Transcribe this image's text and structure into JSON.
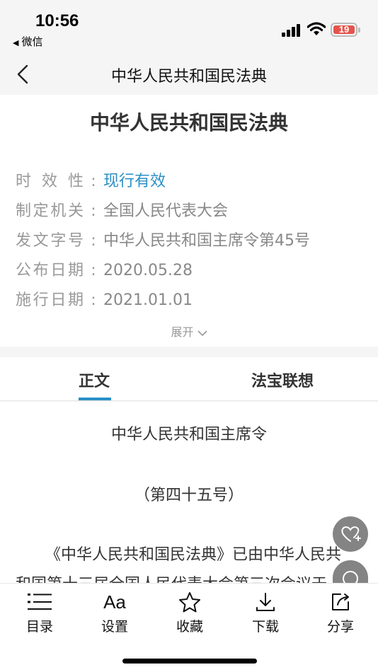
{
  "status_bar": {
    "time": "10:56",
    "back_app": "微信",
    "battery": "19",
    "battery_color": "#e5534b"
  },
  "nav": {
    "title": "中华人民共和国民法典"
  },
  "document": {
    "title": "中华人民共和国民法典",
    "meta": [
      {
        "label": "时效性",
        "value": "现行有效"
      },
      {
        "label": "制定机关",
        "value": "全国人民代表大会"
      },
      {
        "label": "发文字号",
        "value": "中华人民共和国主席令第45号"
      },
      {
        "label": "公布日期",
        "value": "2020.05.28"
      },
      {
        "label": "施行日期",
        "value": "2021.01.01"
      }
    ],
    "expand_label": "展开"
  },
  "tabs": [
    {
      "label": "正文",
      "active": true
    },
    {
      "label": "法宝联想",
      "active": false
    }
  ],
  "content": {
    "heading": "中华人民共和国主席令",
    "number": "（第四十五号）",
    "line1": "《中华人民共和国民法典》已由中华人民共",
    "line2": "和国第十三届全国人民代表大会第三次会议于"
  },
  "toolbar": [
    {
      "label": "目录",
      "icon": "list-icon"
    },
    {
      "label": "设置",
      "icon": "font-size-icon"
    },
    {
      "label": "收藏",
      "icon": "star-icon"
    },
    {
      "label": "下载",
      "icon": "download-icon"
    },
    {
      "label": "分享",
      "icon": "share-icon"
    }
  ],
  "accent_color": "#2a8fc7"
}
